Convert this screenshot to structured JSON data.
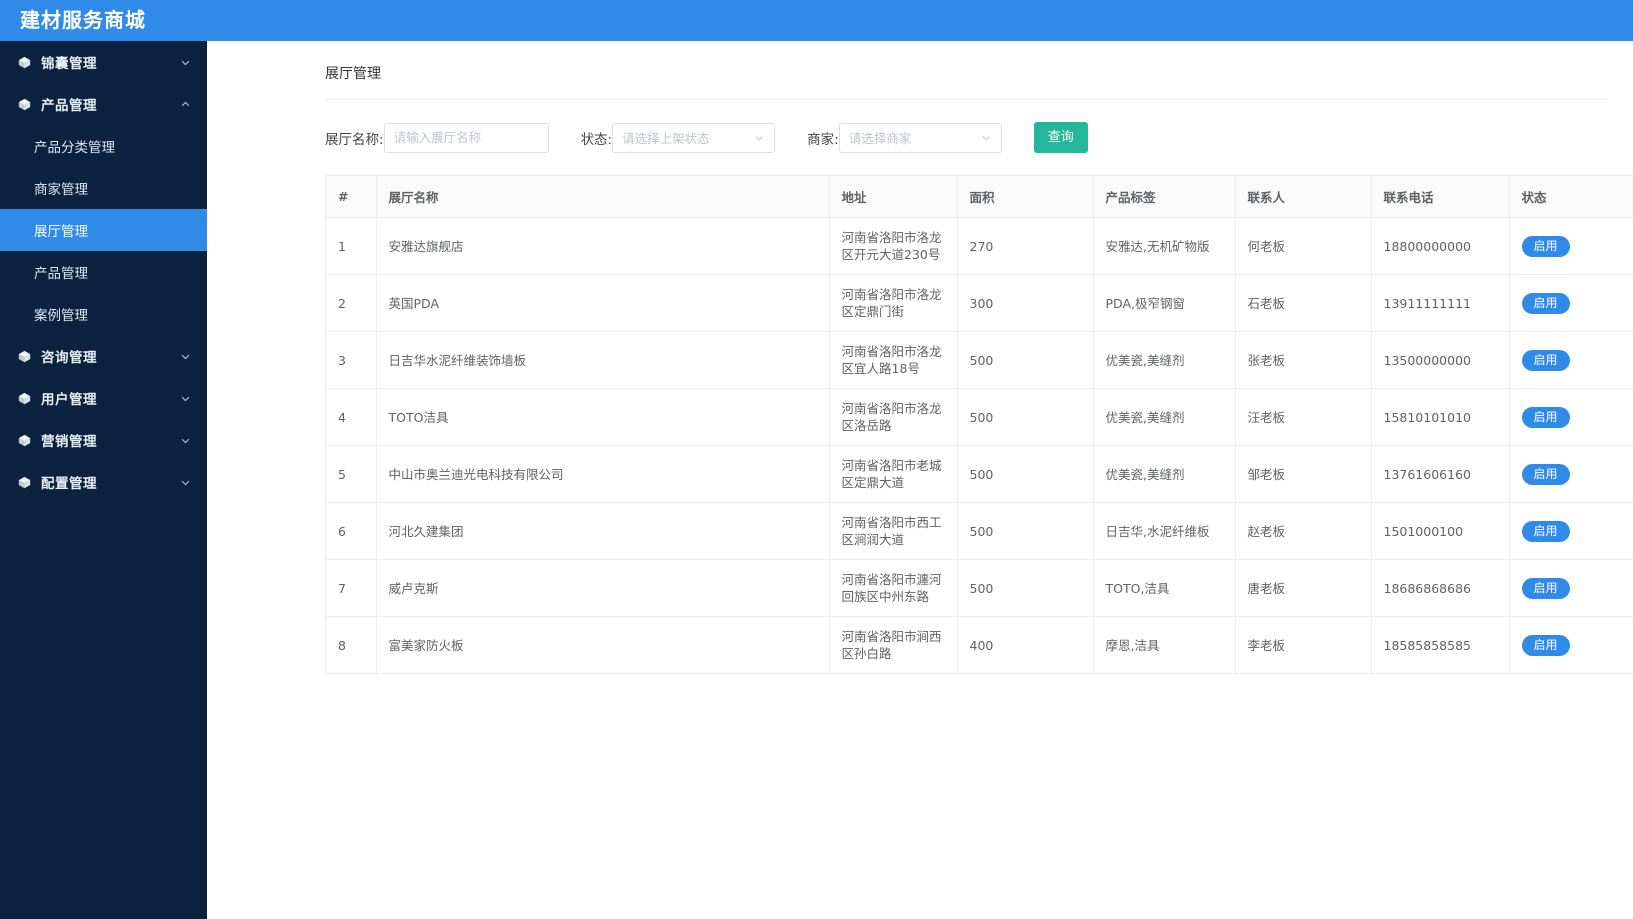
{
  "header": {
    "brand": "建材服务商城"
  },
  "sidebar": {
    "items": [
      {
        "label": "锦囊管理",
        "icon": "cube-icon",
        "expanded": false,
        "chevron": "chevron-down-icon"
      },
      {
        "label": "产品管理",
        "icon": "cube-icon",
        "expanded": true,
        "chevron": "chevron-up-icon"
      },
      {
        "label": "咨询管理",
        "icon": "cube-icon",
        "expanded": false,
        "chevron": "chevron-down-icon"
      },
      {
        "label": "用户管理",
        "icon": "cube-icon",
        "expanded": false,
        "chevron": "chevron-down-icon"
      },
      {
        "label": "营销管理",
        "icon": "cube-icon",
        "expanded": false,
        "chevron": "chevron-down-icon"
      },
      {
        "label": "配置管理",
        "icon": "cube-icon",
        "expanded": false,
        "chevron": "chevron-down-icon"
      }
    ],
    "product_submenu": [
      {
        "label": "产品分类管理",
        "active": false
      },
      {
        "label": "商家管理",
        "active": false
      },
      {
        "label": "展厅管理",
        "active": true
      },
      {
        "label": "产品管理",
        "active": false
      },
      {
        "label": "案例管理",
        "active": false
      }
    ],
    "active_item": "展厅管理",
    "background_color": "#0c2340",
    "active_color": "#2f8ae8"
  },
  "main": {
    "page_title": "展厅管理",
    "filters": {
      "name_label": "展厅名称:",
      "name_placeholder": "请输入展厅名称",
      "name_value": "",
      "status_label": "状态:",
      "status_placeholder": "请选择上架状态",
      "status_value": "",
      "merchant_label": "商家:",
      "merchant_placeholder": "请选择商家",
      "merchant_value": "",
      "query_button": "查询",
      "query_button_color": "#25b79b"
    },
    "table": {
      "columns": [
        "#",
        "展厅名称",
        "地址",
        "面积",
        "产品标签",
        "联系人",
        "联系电话",
        "状态"
      ],
      "rows": [
        {
          "index": "1",
          "name": "安雅达旗舰店",
          "address": "河南省洛阳市洛龙区开元大道230号",
          "area": "270",
          "tags": "安雅达,无机矿物版",
          "contact": "何老板",
          "phone": "18800000000",
          "status": "启用"
        },
        {
          "index": "2",
          "name": "英国PDA",
          "address": "河南省洛阳市洛龙区定鼎门街",
          "area": "300",
          "tags": "PDA,极窄钢窗",
          "contact": "石老板",
          "phone": "13911111111",
          "status": "启用"
        },
        {
          "index": "3",
          "name": "日吉华水泥纤维装饰墙板",
          "address": "河南省洛阳市洛龙区宜人路18号",
          "area": "500",
          "tags": "优美瓷,美缝剂",
          "contact": "张老板",
          "phone": "13500000000",
          "status": "启用"
        },
        {
          "index": "4",
          "name": "TOTO洁具",
          "address": "河南省洛阳市洛龙区洛岳路",
          "area": "500",
          "tags": "优美瓷,美缝剂",
          "contact": "汪老板",
          "phone": "15810101010",
          "status": "启用"
        },
        {
          "index": "5",
          "name": "中山市奥兰迪光电科技有限公司",
          "address": "河南省洛阳市老城区定鼎大道",
          "area": "500",
          "tags": "优美瓷,美缝剂",
          "contact": "邹老板",
          "phone": "13761606160",
          "status": "启用"
        },
        {
          "index": "6",
          "name": "河北久建集团",
          "address": "河南省洛阳市西工区涧润大道",
          "area": "500",
          "tags": "日吉华,水泥纤维板",
          "contact": "赵老板",
          "phone": "1501000100",
          "status": "启用"
        },
        {
          "index": "7",
          "name": "威卢克斯",
          "address": "河南省洛阳市瀍河回族区中州东路",
          "area": "500",
          "tags": "TOTO,洁具",
          "contact": "唐老板",
          "phone": "18686868686",
          "status": "启用"
        },
        {
          "index": "8",
          "name": "富美家防火板",
          "address": "河南省洛阳市涧西区孙白路",
          "area": "400",
          "tags": "摩恩,洁具",
          "contact": "李老板",
          "phone": "18585858585",
          "status": "启用"
        }
      ],
      "status_badge_color": "#2f8ae8"
    }
  }
}
